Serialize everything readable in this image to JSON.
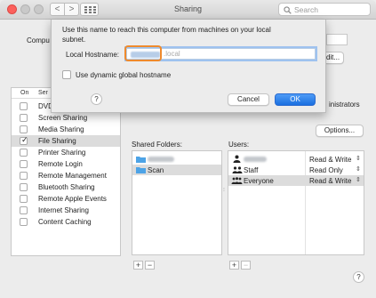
{
  "window": {
    "title": "Sharing",
    "search_placeholder": "Search",
    "back_glyph": "<",
    "forward_glyph": ">"
  },
  "background": {
    "computer_name_label": "Compu",
    "edit_button": "dit...",
    "administrators_text": "inistrators",
    "options_button": "Options...",
    "help_glyph": "?"
  },
  "services": {
    "header_on": "On",
    "header_service": "Ser",
    "items": [
      {
        "label": "DVD",
        "checked": false,
        "selected": false
      },
      {
        "label": "Screen Sharing",
        "checked": false,
        "selected": false
      },
      {
        "label": "Media Sharing",
        "checked": false,
        "selected": false
      },
      {
        "label": "File Sharing",
        "checked": true,
        "selected": true
      },
      {
        "label": "Printer Sharing",
        "checked": false,
        "selected": false
      },
      {
        "label": "Remote Login",
        "checked": false,
        "selected": false
      },
      {
        "label": "Remote Management",
        "checked": false,
        "selected": false
      },
      {
        "label": "Bluetooth Sharing",
        "checked": false,
        "selected": false
      },
      {
        "label": "Remote Apple Events",
        "checked": false,
        "selected": false
      },
      {
        "label": "Internet Sharing",
        "checked": false,
        "selected": false
      },
      {
        "label": "Content Caching",
        "checked": false,
        "selected": false
      }
    ]
  },
  "shared_folders": {
    "label": "Shared Folders:",
    "items": [
      "Scan"
    ],
    "add": "+",
    "remove": "−"
  },
  "users": {
    "label": "Users:",
    "rows": [
      {
        "name": "",
        "perm": "Read & Write"
      },
      {
        "name": "Staff",
        "perm": "Read Only"
      },
      {
        "name": "Everyone",
        "perm": "Read & Write"
      }
    ],
    "add": "+",
    "remove": "−"
  },
  "sheet": {
    "message": "Use this name to reach this computer from machines on your local subnet.",
    "hostname_label": "Local Hostname:",
    "hostname_suffix": ".local",
    "dynamic_label": "Use dynamic global hostname",
    "help": "?",
    "cancel": "Cancel",
    "ok": "OK"
  },
  "colors": {
    "accent": "#1a6fe0",
    "focus_ring": "#ef8a2c",
    "close_light": "#fc605c"
  }
}
